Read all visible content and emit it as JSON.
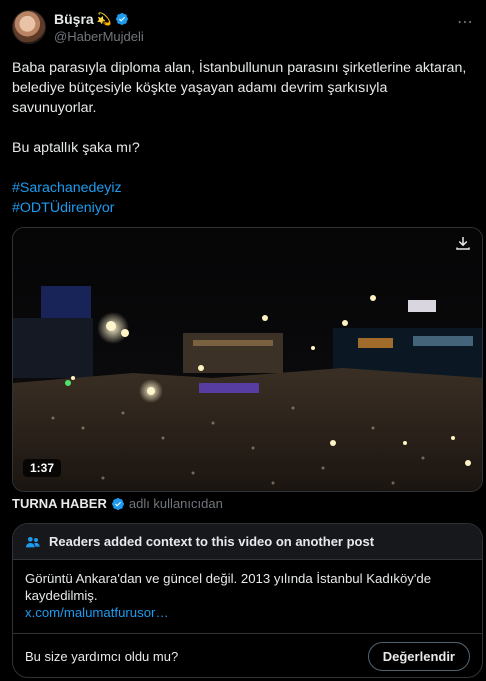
{
  "author": {
    "name": "Büşra",
    "emoji": "💫",
    "handle": "@HaberMujdeli",
    "verified": true
  },
  "tweet": {
    "paragraph1": "Baba parasıyla diploma alan, İstanbullunun parasını şirketlerine aktaran, belediye bütçesiyle köşkte yaşayan adamı devrim şarkısıyla savunuyorlar.",
    "paragraph2": "Bu aptallık şaka mı?",
    "hashtags": [
      "#Sarachanedeyiz",
      "#ODTÜdireniyor"
    ]
  },
  "video": {
    "duration": "1:37"
  },
  "source": {
    "name": "TURNA HABER",
    "suffix": "adlı kullanıcıdan"
  },
  "community_note": {
    "header": "Readers added context to this video on another post",
    "body": "Görüntü Ankara'dan ve güncel değil. 2013 yılında İstanbul Kadıköy'de kaydedilmiş.",
    "link": "x.com/malumatfurusor…",
    "question": "Bu size yardımcı oldu mu?",
    "rate_button": "Değerlendir"
  },
  "colors": {
    "background": "#000000",
    "accent": "#1d9bf0",
    "muted": "#71767b",
    "border": "#2f3336"
  }
}
